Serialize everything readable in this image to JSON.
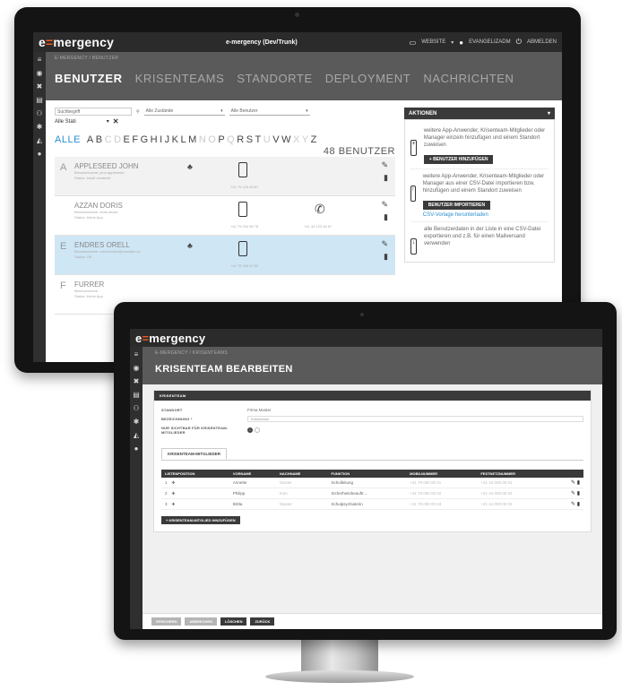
{
  "back": {
    "logo_prefix": "e",
    "logo_eq": "=",
    "logo_rest": "mergency",
    "instance": "e-mergency (Dev/Trunk)",
    "website_label": "WEBSITE",
    "user_label": "EVANGELIZADM",
    "logout_label": "ABMELDEN",
    "breadcrumb": "E-MERGENCY / BENUTZER",
    "tabs": [
      "BENUTZER",
      "KRISENTEAMS",
      "STANDORTE",
      "DEPLOYMENT",
      "NACHRICHTEN"
    ],
    "search_placeholder": "Suchbegriff",
    "filter_status": "Alle Zustände",
    "filter_users": "Alle Benutzer",
    "filter_location": "Alle Stati",
    "alphabet_all": "ALLE",
    "alphabet": [
      "A",
      "B",
      "C",
      "D",
      "E",
      "F",
      "G",
      "H",
      "I",
      "J",
      "K",
      "L",
      "M",
      "N",
      "O",
      "P",
      "Q",
      "R",
      "S",
      "T",
      "U",
      "V",
      "W",
      "X",
      "Y",
      "Z"
    ],
    "user_count": "48 BENUTZER",
    "users": [
      {
        "initial": "A",
        "name": "APPLESEED JOHN",
        "line1": "Benutzername: john.appleseed",
        "line2": "Status: Inhalt versteckt",
        "mobile": "+41 79 123 45 67",
        "phone": ""
      },
      {
        "initial": "",
        "name": "AZZAN DORIS",
        "line1": "Benutzername: doris.azzan",
        "line2": "Status: Keine App",
        "mobile": "+41 79 234 56 78",
        "phone": "+41 44 123 45 67"
      },
      {
        "initial": "E",
        "name": "ENDRES ORELL",
        "line1": "Benutzername: orell.endres@example.ch",
        "line2": "Status: OK",
        "mobile": "+41 78 345 67 89",
        "phone": ""
      },
      {
        "initial": "F",
        "name": "FURRER",
        "line1": "Benutzername:",
        "line2": "Status: Keine App",
        "mobile": "",
        "phone": ""
      }
    ],
    "actions_title": "AKTIONEN",
    "actions": [
      {
        "text": "weitere App-Anwender, Krisenteam-Mitglieder oder Manager einzeln hinzufügen und einem Standort zuweisen",
        "button": "BENUTZER HINZUFÜGEN",
        "link": ""
      },
      {
        "text": "weitere App-Anwender, Krisenteam-Mitglieder oder Manager aus einer CSV-Datei importieren bzw. hinzufügen und einem Standort zuweisen",
        "button": "BENUTZER IMPORTIEREN",
        "link": "CSV-Vorlage herunterladen"
      },
      {
        "text": "alle Benutzerdaten in der Liste in eine CSV-Datei exportieren und z.B. für einen Mailversand verwenden",
        "button": "",
        "link": ""
      }
    ]
  },
  "front": {
    "logo_prefix": "e",
    "logo_eq": "=",
    "logo_rest": "mergency",
    "breadcrumb": "E-MERGENCY / KRISENTEAMS",
    "title": "KRISENTEAM BEARBEITEN",
    "panel_title": "KRISENTEAM",
    "standort_label": "STANDORT",
    "standort_value": "Firma Muster",
    "bezeichnung_label": "BEZEICHNUNG *",
    "bezeichnung_value": "Krisenteam",
    "sichtbar_label": "NUR SICHTBAR FÜR KRISENTEAM-MITGLIEDER",
    "subtab": "KRISENTEAM-MITGLIEDER",
    "columns": [
      "LISTENPOSITION",
      "VORNAME",
      "NACHNAME",
      "FUNKTION",
      "MOBILNUMMER",
      "FESTNETZNUMMER",
      ""
    ],
    "rows": [
      {
        "pos": "1",
        "first": "Annette",
        "last": "Muster",
        "role": "Schulleitung",
        "mobile": "+41 79 000 00 01",
        "phone": "+41 44 000 00 01"
      },
      {
        "pos": "2",
        "first": "Philipp",
        "last": "Imm",
        "role": "Sicherheitsbeauftr...",
        "mobile": "+41 79 000 00 02",
        "phone": "+41 44 000 00 02"
      },
      {
        "pos": "3",
        "first": "Britta",
        "last": "Muster",
        "role": "Schulpsychiaterin",
        "mobile": "+41 79 000 00 03",
        "phone": "+41 44 000 00 03"
      }
    ],
    "add_member": "KRISENTEAM-MITGLIED HINZUFÜGEN",
    "footer": [
      "SPEICHERN",
      "ABBRECHEN",
      "LÖSCHEN",
      "ZURÜCK"
    ]
  }
}
